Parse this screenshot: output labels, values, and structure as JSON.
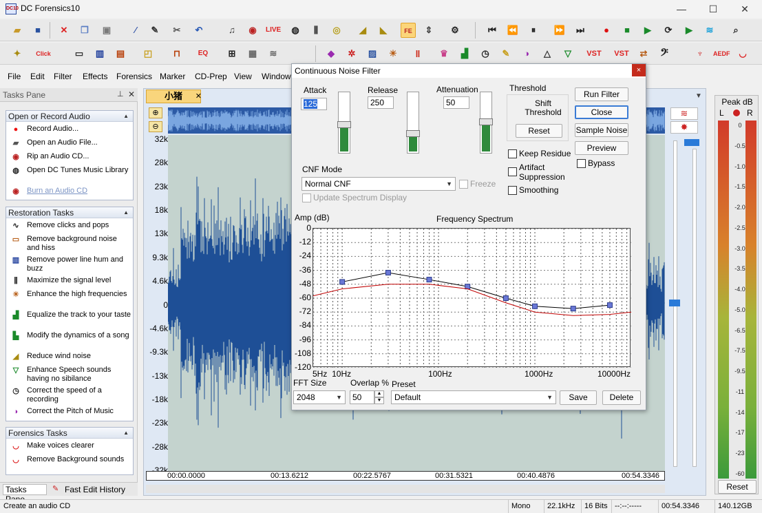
{
  "app": {
    "title": "DC Forensics10",
    "icon": "DC10"
  },
  "menu": [
    "File",
    "Edit",
    "Filter",
    "Effects",
    "Forensics",
    "Marker",
    "CD-Prep",
    "View",
    "Window"
  ],
  "tasks_pane": {
    "title": "Tasks Pane",
    "sections": [
      {
        "title": "Open or Record Audio",
        "items": [
          "Record Audio...",
          "Open an Audio File...",
          "Rip an Audio CD...",
          "Open DC Tunes Music Library",
          "Burn an Audio CD"
        ]
      },
      {
        "title": "Restoration Tasks",
        "items": [
          "Remove clicks and pops",
          "Remove background noise and hiss",
          "Remove power line hum and buzz",
          "Maximize the signal level",
          "Enhance the high frequencies",
          "Equalize the track to your taste",
          "Modify the dynamics of a song",
          "Reduce wind noise",
          "Enhance Speech sounds having no sibilance",
          "Correct the speed of a recording",
          "Correct the Pitch of Music"
        ]
      },
      {
        "title": "Forensics Tasks",
        "items": [
          "Make voices clearer",
          "Remove Background sounds"
        ]
      }
    ],
    "bottom_tabs": [
      "Tasks Pane",
      "Fast Edit History"
    ]
  },
  "document": {
    "tab": "小猪",
    "y_labels": [
      "32k",
      "28k",
      "23k",
      "18k",
      "13k",
      "9.3k",
      "4.6k",
      "0",
      "-4.6k",
      "-9.3k",
      "-13k",
      "-18k",
      "-23k",
      "-28k",
      "-32k"
    ],
    "timeline": [
      "00:00.0000",
      "00:13.6212",
      "00:22.5767",
      "00:31.5321",
      "00:40.4876",
      "00:54.3346"
    ]
  },
  "peak_meter": {
    "title": "Peak dB",
    "left": "L",
    "right": "R",
    "scale": [
      "0",
      "-0.5",
      "-1.0",
      "-1.5",
      "-2.0",
      "-2.5",
      "-3.0",
      "-3.5",
      "-4.0",
      "-5.0",
      "-6.5",
      "-7.5",
      "-9.5",
      "-11",
      "-14",
      "-17",
      "-23",
      "-60"
    ],
    "reset": "Reset"
  },
  "dialog": {
    "title": "Continuous Noise Filter",
    "close": "×",
    "attack": {
      "label": "Attack",
      "value": "125",
      "level": 0.45
    },
    "release": {
      "label": "Release",
      "value": "250",
      "level": 0.3
    },
    "attenuation": {
      "label": "Attenuation",
      "value": "50",
      "level": 0.5
    },
    "threshold": {
      "label": "Threshold",
      "shift": "Shift Threshold",
      "reset": "Reset"
    },
    "buttons": {
      "run": "Run Filter",
      "close": "Close",
      "sample": "Sample Noise",
      "preview": "Preview"
    },
    "bypass": "Bypass",
    "checks": {
      "keep_residue": "Keep Residue",
      "artifact": "Artifact Suppression",
      "smoothing": "Smoothing",
      "freeze": "Freeze",
      "update_spectrum": "Update Spectrum Display"
    },
    "cnf_mode": {
      "label": "CNF Mode",
      "value": "Normal CNF"
    },
    "fft": {
      "label": "FFT Size",
      "value": "2048"
    },
    "overlap": {
      "label": "Overlap %",
      "value": "50"
    },
    "preset": {
      "label": "Preset",
      "value": "Default",
      "save": "Save",
      "delete": "Delete"
    }
  },
  "chart_data": {
    "type": "line",
    "title": "Frequency Spectrum",
    "ylabel": "Amp (dB)",
    "xlabel": "",
    "x_scale": "log",
    "xlim": [
      5,
      10000
    ],
    "ylim": [
      -120,
      0
    ],
    "y_ticks": [
      "0",
      "-12",
      "-24",
      "-36",
      "-48",
      "-60",
      "-72",
      "-84",
      "-96",
      "-108",
      "-120"
    ],
    "x_ticks": [
      "5Hz",
      "10Hz",
      "100Hz",
      "1000Hz",
      "10000Hz"
    ],
    "grid": true,
    "series": [
      {
        "color": "#000000",
        "marker": "square",
        "x": [
          10,
          30,
          80,
          200,
          500,
          1000,
          2500,
          6000
        ],
        "y": [
          -46,
          -38,
          -44,
          -50,
          -60,
          -67,
          -69,
          -66
        ]
      },
      {
        "color": "#c00000",
        "x": [
          5,
          10,
          30,
          80,
          200,
          500,
          1000,
          2500,
          6000,
          10000
        ],
        "y": [
          -58,
          -52,
          -48,
          -48,
          -52,
          -64,
          -72,
          -75,
          -74,
          -72
        ]
      }
    ]
  },
  "status": {
    "left": "Create an audio CD",
    "channels": "Mono",
    "rate": "22.1kHz",
    "bits": "16 Bits",
    "sel": "--:--:-----",
    "len": "00:54.3346",
    "disk": "140.12GB"
  }
}
